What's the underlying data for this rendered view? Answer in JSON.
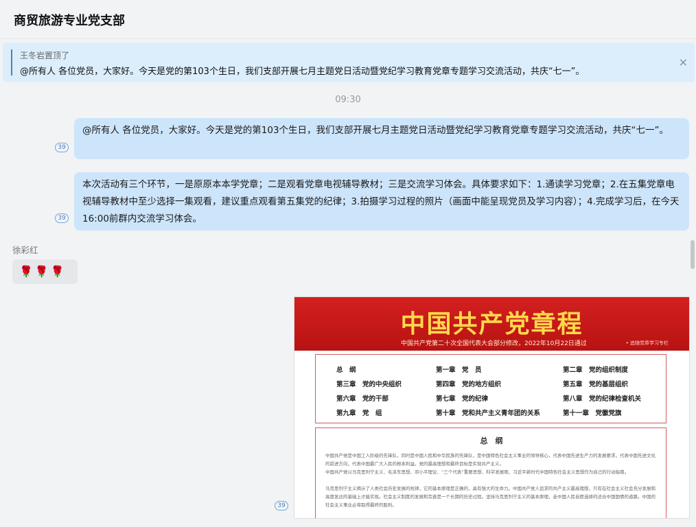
{
  "header": {
    "title": "商贸旅游专业党支部"
  },
  "pinned": {
    "by": "王冬岩置顶了",
    "text": "@所有人 各位党员，大家好。今天是党的第103个生日，我们支部开展七月主题党日活动暨党纪学习教育党章专题学习交流活动，共庆“七一”。",
    "close": "×"
  },
  "time": "09:30",
  "messages": [
    {
      "text": "@所有人  各位党员，大家好。今天是党的第103个生日，我们支部开展七月主题党日活动暨党纪学习教育党章专题学习交流活动，共庆“七一”。",
      "read": "39"
    },
    {
      "text": "本次活动有三个环节，一是原原本本学党章；二是观看党章电视辅导教材；三是交流学习体会。具体要求如下：1.通读学习党章；2.在五集党章电视辅导教材中至少选择一集观看，建议重点观看第五集党的纪律；3.拍摄学习过程的照片（画面中能呈现党员及学习内容）；4.完成学习后，在今天16:00前群内交流学习体会。",
      "read": "39"
    }
  ],
  "reply": {
    "sender": "徐彩红",
    "content": "🌹🌹🌹"
  },
  "image_message": {
    "read": "39",
    "title": "中国共产党章程",
    "subtitle": "中国共产党第二十次全国代表大会部分修改，2022年10月22日通过",
    "source": "• 追随党章学习专栏",
    "toc": [
      [
        "总　纲",
        "第一章　党　员",
        "第二章　党的组织制度"
      ],
      [
        "第三章　党的中央组织",
        "第四章　党的地方组织",
        "第五章　党的基层组织"
      ],
      [
        "第六章　党的干部",
        "第七章　党的纪律",
        "第八章　党的纪律检查机关"
      ],
      [
        "第九章　党　组",
        "第十章　党和共产主义青年团的关系",
        "第十一章　党徽党旗"
      ]
    ],
    "section_title": "总　纲",
    "paragraphs": [
      "中国共产党是中国工人阶级的先锋队，同时是中国人民和中华民族的先锋队，是中国特色社会主义事业的领导核心，代表中国先进生产力的发展要求，代表中国先进文化的前进方向，代表中国最广大人民的根本利益。党的最高理想和最终目标是实现共产主义。",
      "中国共产党以马克思列宁主义、毛泽东思想、邓小平理论、“三个代表”重要思想、科学发展观、习近平新时代中国特色社会主义思想作为自己的行动指南。",
      "马克思列宁主义揭示了人类社会历史发展的规律，它的基本原理是正确的，具有强大的生命力。中国共产党人追求的共产主义最高理想，只有在社会主义社会充分发展和高度发达的基础上才能实现。社会主义制度的发展和完善是一个长期的历史过程。坚持马克思列宁主义的基本原理，走中国人民自愿选择的适合中国国情的道路，中国的社会主义事业必将取得最终的胜利。"
    ]
  }
}
